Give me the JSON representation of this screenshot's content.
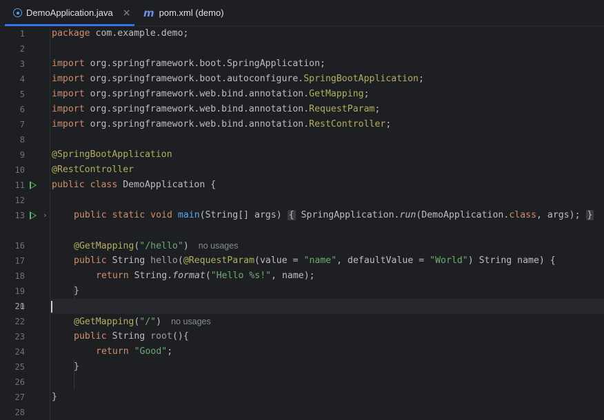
{
  "tabs": [
    {
      "label": "DemoApplication.java",
      "icon": "java-class-icon",
      "active": true
    },
    {
      "label": "pom.xml (demo)",
      "icon": "maven-icon",
      "active": false
    }
  ],
  "tab_close": "×",
  "line_numbers": [
    "1",
    "2",
    "3",
    "4",
    "5",
    "6",
    "7",
    "8",
    "9",
    "10",
    "11",
    "12",
    "13",
    "16",
    "17",
    "18",
    "19",
    "20",
    "21",
    "22",
    "23",
    "24",
    "25",
    "26",
    "27",
    "28"
  ],
  "code": {
    "l1_kw": "package",
    "l1_rest": " com.example.demo;",
    "import_kw": "import",
    "l3": " org.springframework.boot.SpringApplication;",
    "l4_pre": " org.springframework.boot.autoconfigure.",
    "l4_cls": "SpringBootApplication",
    "l5_pre": " org.springframework.web.bind.annotation.",
    "l5_cls": "GetMapping",
    "l6_cls": "RequestParam",
    "l7_cls": "RestController",
    "semi": ";",
    "l9": "@SpringBootApplication",
    "l10": "@RestController",
    "l11_kw": "public class",
    "l11_rest": " DemoApplication {",
    "l13_kw": "public static void",
    "l13_fn": "main",
    "l13_args": "(String[] args)",
    "l13_ob": "{",
    "l13_body1": " SpringApplication.",
    "l13_run": "run",
    "l13_body2": "(DemoApplication.",
    "l13_classkw": "class",
    "l13_body3": ", args);",
    "l13_cb": "}",
    "l17_ann": "@GetMapping",
    "l17_open": "(",
    "l17_str": "\"/hello\"",
    "l17_close": ")",
    "no_usages": "no usages",
    "l18_kw": "public",
    "l18_type": " String ",
    "l18_fn": "hello",
    "l18_p1": "(",
    "l18_ann": "@RequestParam",
    "l18_p2": "(value = ",
    "l18_s1": "\"name\"",
    "l18_p3": ", defaultValue = ",
    "l18_s2": "\"World\"",
    "l18_p4": ") String name) {",
    "l19_kw": "return",
    "l19_a": " String.",
    "l19_fmt": "format",
    "l19_b": "(",
    "l19_str": "\"Hello %s!\"",
    "l19_c": ", name);",
    "close_brace": "}",
    "l22_str": "\"/\"",
    "l23_fn": "root",
    "l23_rest": "(){",
    "l24_str": "\"Good\""
  }
}
